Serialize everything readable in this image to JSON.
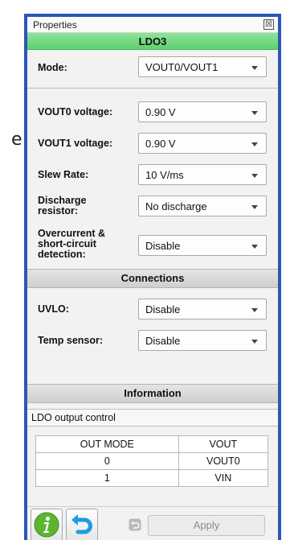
{
  "background": {
    "partial_text": "e"
  },
  "titlebar": {
    "title": "Properties",
    "close_glyph": "☒"
  },
  "device": {
    "name": "LDO3"
  },
  "mode": {
    "label": "Mode:",
    "value": "VOUT0/VOUT1"
  },
  "settings": [
    {
      "label_lines": [
        "VOUT0 voltage:"
      ],
      "value": "0.90 V"
    },
    {
      "label_lines": [
        "VOUT1 voltage:"
      ],
      "value": "0.90 V"
    },
    {
      "label_lines": [
        "Slew Rate:"
      ],
      "value": "10 V/ms"
    },
    {
      "label_lines": [
        "Discharge",
        "resistor:"
      ],
      "value": "No discharge"
    },
    {
      "label_lines": [
        "Overcurrent &",
        "short-circuit",
        "detection:"
      ],
      "value": "Disable"
    }
  ],
  "connections": {
    "header": "Connections",
    "items": [
      {
        "label": "UVLO:",
        "value": "Disable"
      },
      {
        "label": "Temp sensor:",
        "value": "Disable"
      }
    ]
  },
  "information": {
    "header": "Information",
    "description": "LDO output control",
    "table": {
      "columns": [
        "OUT MODE",
        "VOUT"
      ],
      "rows": [
        [
          "0",
          "VOUT0"
        ],
        [
          "1",
          "VIN"
        ]
      ]
    }
  },
  "footer": {
    "apply_label": "Apply"
  },
  "icons": {
    "info": "info-icon",
    "undo": "undo-icon",
    "revert": "revert-icon",
    "close": "close-icon",
    "dropdown": "chevron-down-icon"
  },
  "colors": {
    "accent_border": "#2b58b5",
    "device_header": "#6dd87c",
    "info_icon": "#5cb531",
    "undo_icon": "#1e9be0"
  }
}
